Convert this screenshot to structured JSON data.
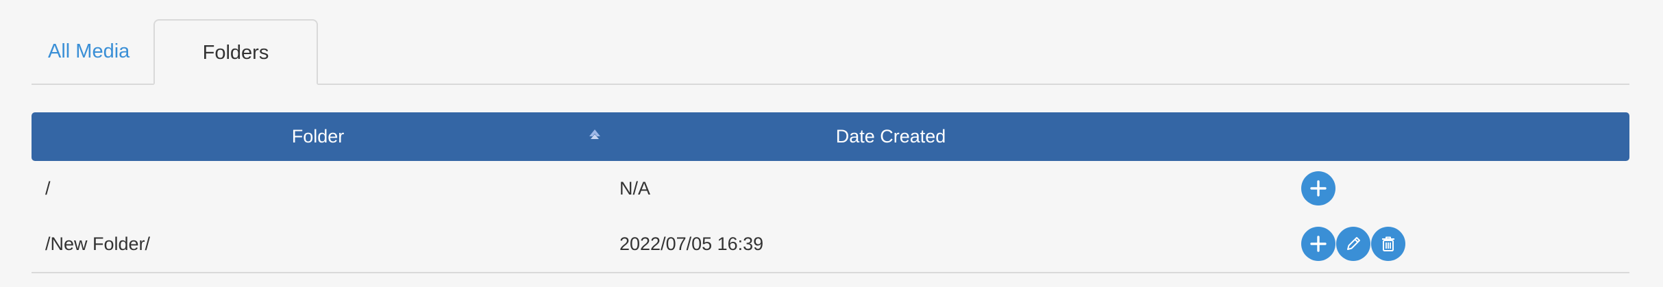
{
  "tabs": [
    {
      "label": "All Media",
      "active": false
    },
    {
      "label": "Folders",
      "active": true
    }
  ],
  "table": {
    "columns": {
      "folder": "Folder",
      "date_created": "Date Created"
    },
    "sort": {
      "column": "folder",
      "direction": "ascending",
      "icon": "sort-up-icon"
    },
    "rows": [
      {
        "folder": "/",
        "date_created": "N/A",
        "actions": [
          "add-icon"
        ]
      },
      {
        "folder": "/New Folder/",
        "date_created": "2022/07/05 16:39",
        "actions": [
          "add-icon",
          "edit-icon",
          "delete-icon"
        ]
      }
    ]
  },
  "colors": {
    "accent": "#3a8fd6",
    "header_bg": "#3466a5",
    "background": "#f6f6f6"
  }
}
